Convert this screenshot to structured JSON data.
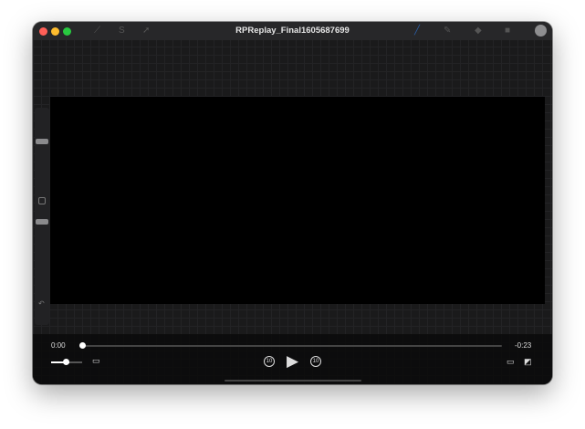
{
  "window": {
    "title": "RPReplay_Final1605687699"
  },
  "player": {
    "elapsed": "0:00",
    "remaining": "-0:23",
    "progress": 0,
    "volume": 0.6,
    "skip_back_label": "10",
    "skip_forward_label": "10"
  },
  "colors": {
    "close": "#ff5f57",
    "minimize": "#febc2e",
    "zoom": "#28c840",
    "brush": "#2b5fa8"
  }
}
